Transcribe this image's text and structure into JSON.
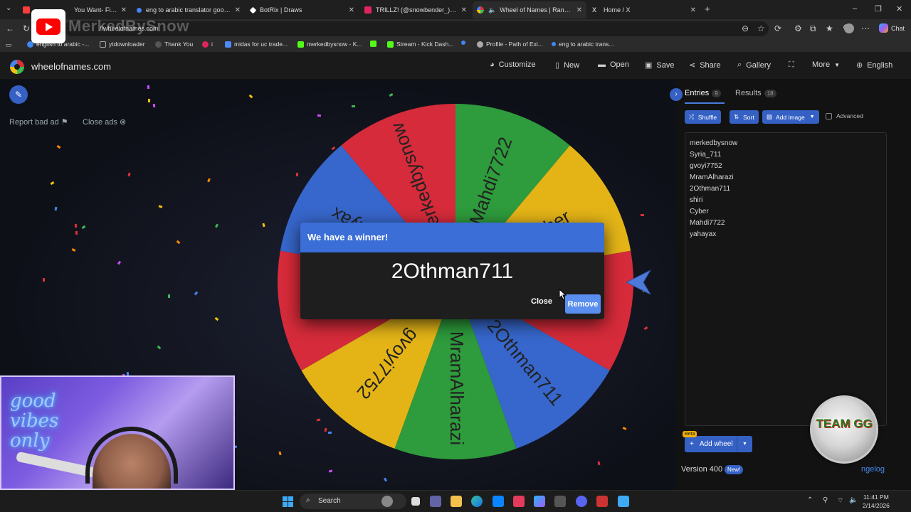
{
  "browser": {
    "tabs": [
      {
        "title": "You Want- Fiji (DSP)",
        "color": "#ff3b3b"
      },
      {
        "title": "eng to arabic translator google - S",
        "color": "#4285f4"
      },
      {
        "title": "BotRix | Draws",
        "color": "#ffffff"
      },
      {
        "title": "TRILLZ! (@snowbender_) • B",
        "color": "#e0245e"
      },
      {
        "title": "Wheel of Names | Random n",
        "color": "#4885ed"
      },
      {
        "title": "Home / X",
        "color": "#ffffff"
      }
    ],
    "url": "//wheelofnames.com",
    "bookmarks": [
      {
        "label": "english to arabic -...",
        "color": "#4285f4"
      },
      {
        "label": "ytdownloader",
        "color": "#888888"
      },
      {
        "label": "Thank You",
        "color": "#555555"
      },
      {
        "label": "i",
        "color": "#e0245e"
      },
      {
        "label": "midas for uc trade...",
        "color": "#4c8bf5"
      },
      {
        "label": "merkedbysnow - K...",
        "color": "#53fc18"
      },
      {
        "label": "",
        "color": "#53fc18"
      },
      {
        "label": "Stream - Kick Dash...",
        "color": "#53fc18"
      },
      {
        "label": "",
        "color": "#4285f4"
      },
      {
        "label": "Profile - Path of Exi...",
        "color": "#aaaaaa"
      },
      {
        "label": "eng to arabic trans...",
        "color": "#4285f4"
      }
    ],
    "chat_label": "Chat"
  },
  "site": {
    "name": "wheelofnames.com",
    "nav": [
      {
        "label": "Customize",
        "icon": "palette-icon"
      },
      {
        "label": "New",
        "icon": "file-icon"
      },
      {
        "label": "Open",
        "icon": "folder-icon"
      },
      {
        "label": "Save",
        "icon": "save-icon"
      },
      {
        "label": "Share",
        "icon": "share-icon"
      },
      {
        "label": "Gallery",
        "icon": "search-icon"
      },
      {
        "label": "",
        "icon": "fullscreen-icon"
      },
      {
        "label": "More",
        "icon": "chevron-down-icon"
      },
      {
        "label": "English",
        "icon": "globe-icon"
      }
    ]
  },
  "ads": {
    "report": "Report bad ad",
    "close": "Close ads"
  },
  "wheel": {
    "colors": {
      "red": "#d62b3a",
      "green": "#2e9b3c",
      "yellow": "#e4b417",
      "blue": "#3767cc"
    },
    "segments": [
      "merkedbysnow",
      "Mahdi7722",
      "Cyber",
      "shiri",
      "2Othman711",
      "MramAlharazi",
      "gvoyi7752",
      "Syria_711",
      "yahayax"
    ]
  },
  "modal": {
    "title": "We have a winner!",
    "winner": "2Othman711",
    "close_label": "Close",
    "remove_label": "Remove"
  },
  "panel": {
    "entries_label": "Entries",
    "entries_count": "9",
    "results_label": "Results",
    "results_count": "18",
    "shuffle": "Shuffle",
    "sort": "Sort",
    "add_image": "Add image",
    "advanced": "Advanced",
    "entries": [
      "merkedbysnow",
      "Syria_711",
      "gvoyi7752",
      "MramAlharazi",
      "2Othman711",
      "shiri",
      "Cyber",
      "Mahdi7722",
      "yahayax"
    ],
    "add_wheel": "Add wheel",
    "beta": "Beta",
    "version": "Version 400",
    "new_badge": "New!",
    "changelog": "ngelog"
  },
  "overlay": {
    "watermark": "MerkedBySnow",
    "team_badge": "TEAM GG",
    "neon_sign": "good vibes only"
  },
  "taskbar": {
    "search_label": "Search",
    "time": "11:41 PM",
    "date": "2/14/2026"
  }
}
